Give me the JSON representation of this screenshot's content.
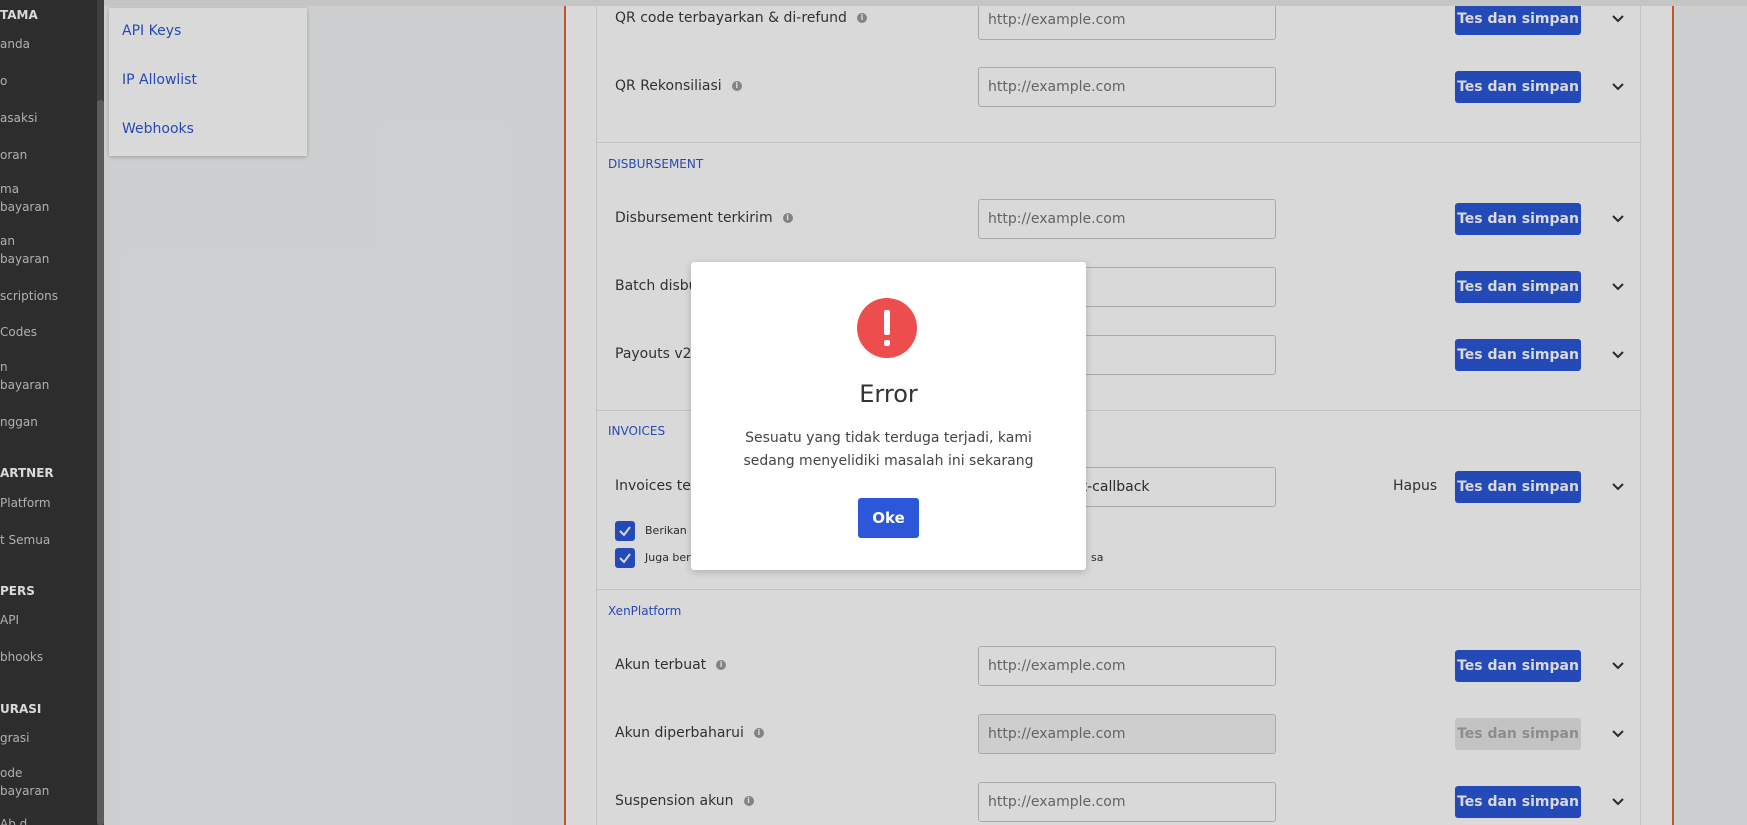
{
  "sidebar": {
    "sections": [
      {
        "title": "TAMA",
        "items": [
          "anda",
          "o",
          "asaksi",
          "oran",
          "ma\nbayaran",
          "an\nbayaran",
          "scriptions",
          "Codes",
          "n\nbayaran",
          "nggan"
        ]
      },
      {
        "title": "ARTNER",
        "items": [
          "Platform",
          "t Semua"
        ]
      },
      {
        "title": "PERS",
        "items": [
          "API",
          "bhooks"
        ]
      },
      {
        "title": "URASI",
        "items": [
          "grasi",
          "ode\nbayaran",
          "Ab d"
        ]
      }
    ]
  },
  "submenu": {
    "items": [
      "API Keys",
      "IP Allowlist",
      "Webhooks"
    ]
  },
  "sections": {
    "disbursement": "DISBURSEMENT",
    "invoices": "INVOICES",
    "xenplatform": "XenPlatform"
  },
  "rows": [
    {
      "label": "QR code terbayarkan & di-refund",
      "placeholder": "http://example.com"
    },
    {
      "label": "QR Rekonsiliasi",
      "placeholder": "http://example.com"
    },
    {
      "label": "Disbursement terkirim",
      "placeholder": "http://example.com"
    },
    {
      "label": "Batch disbu",
      "placeholder": "com"
    },
    {
      "label": "Payouts v2",
      "placeholder": "com"
    },
    {
      "label": "Invoices terb",
      "value": "ka.com/xendit-callback"
    },
    {
      "label": "Akun terbuat",
      "placeholder": "http://example.com"
    },
    {
      "label": "Akun diperbaharui",
      "placeholder": "http://example.com"
    },
    {
      "label": "Suspension akun",
      "placeholder": "http://example.com"
    }
  ],
  "button_label": "Tes dan simpan",
  "hapus_label": "Hapus",
  "checkboxes": [
    {
      "label": "Berikan s"
    },
    {
      "label": "Juga beri",
      "suffix": "sa"
    }
  ],
  "modal": {
    "title": "Error",
    "message": "Sesuatu yang tidak terduga terjadi, kami sedang menyelidiki masalah ini sekarang",
    "ok_label": "Oke",
    "icon": "exclamation-icon"
  },
  "colors": {
    "accent": "#2b57d8",
    "error": "#ee4d4d",
    "panel_border": "#e06630"
  }
}
